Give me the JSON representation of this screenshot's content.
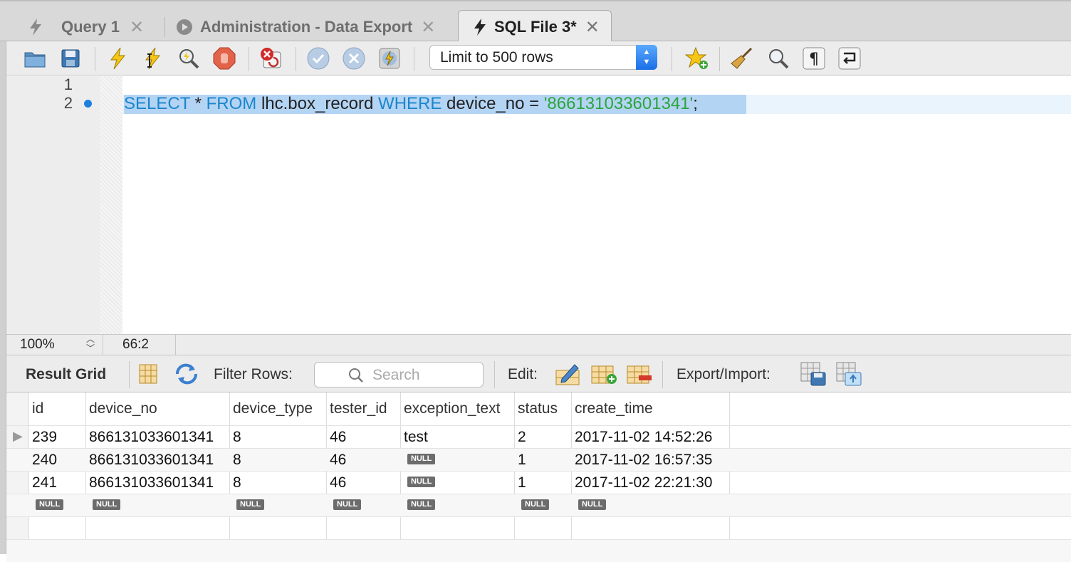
{
  "tabs": [
    {
      "label": "Query 1",
      "icon": "lightning-icon",
      "active": false
    },
    {
      "label": "Administration - Data Export",
      "icon": "play-circle-icon",
      "active": false
    },
    {
      "label": "SQL File 3*",
      "icon": "lightning-icon",
      "active": true
    }
  ],
  "toolbar": {
    "limit_value": "Limit to 500 rows"
  },
  "editor": {
    "line_numbers": [
      "1",
      "2"
    ],
    "sql": {
      "select": "SELECT",
      "star": " * ",
      "from": "FROM",
      "table": " lhc.box_record ",
      "where": "WHERE",
      "cond": " device_no = ",
      "value": "'866131033601341'",
      "end": ";"
    }
  },
  "status": {
    "zoom": "100%",
    "position": "66:2"
  },
  "result_toolbar": {
    "title": "Result Grid",
    "filter_label": "Filter Rows:",
    "search_placeholder": "Search",
    "edit_label": "Edit:",
    "export_label": "Export/Import:"
  },
  "grid": {
    "columns": [
      "id",
      "device_no",
      "device_type",
      "tester_id",
      "exception_text",
      "status",
      "create_time"
    ],
    "rows": [
      [
        "239",
        "866131033601341",
        "8",
        "46",
        "test",
        "2",
        "2017-11-02 14:52:26"
      ],
      [
        "240",
        "866131033601341",
        "8",
        "46",
        "NULL",
        "1",
        "2017-11-02 16:57:35"
      ],
      [
        "241",
        "866131033601341",
        "8",
        "46",
        "NULL",
        "1",
        "2017-11-02 22:21:30"
      ],
      [
        "NULL",
        "NULL",
        "NULL",
        "NULL",
        "NULL",
        "NULL",
        "NULL"
      ]
    ],
    "null_label": "NULL"
  },
  "colors": {
    "keyword": "#1a86cc",
    "string": "#2ba53a",
    "selection": "#b4d4f4",
    "breakpoint": "#1f7fdc"
  }
}
